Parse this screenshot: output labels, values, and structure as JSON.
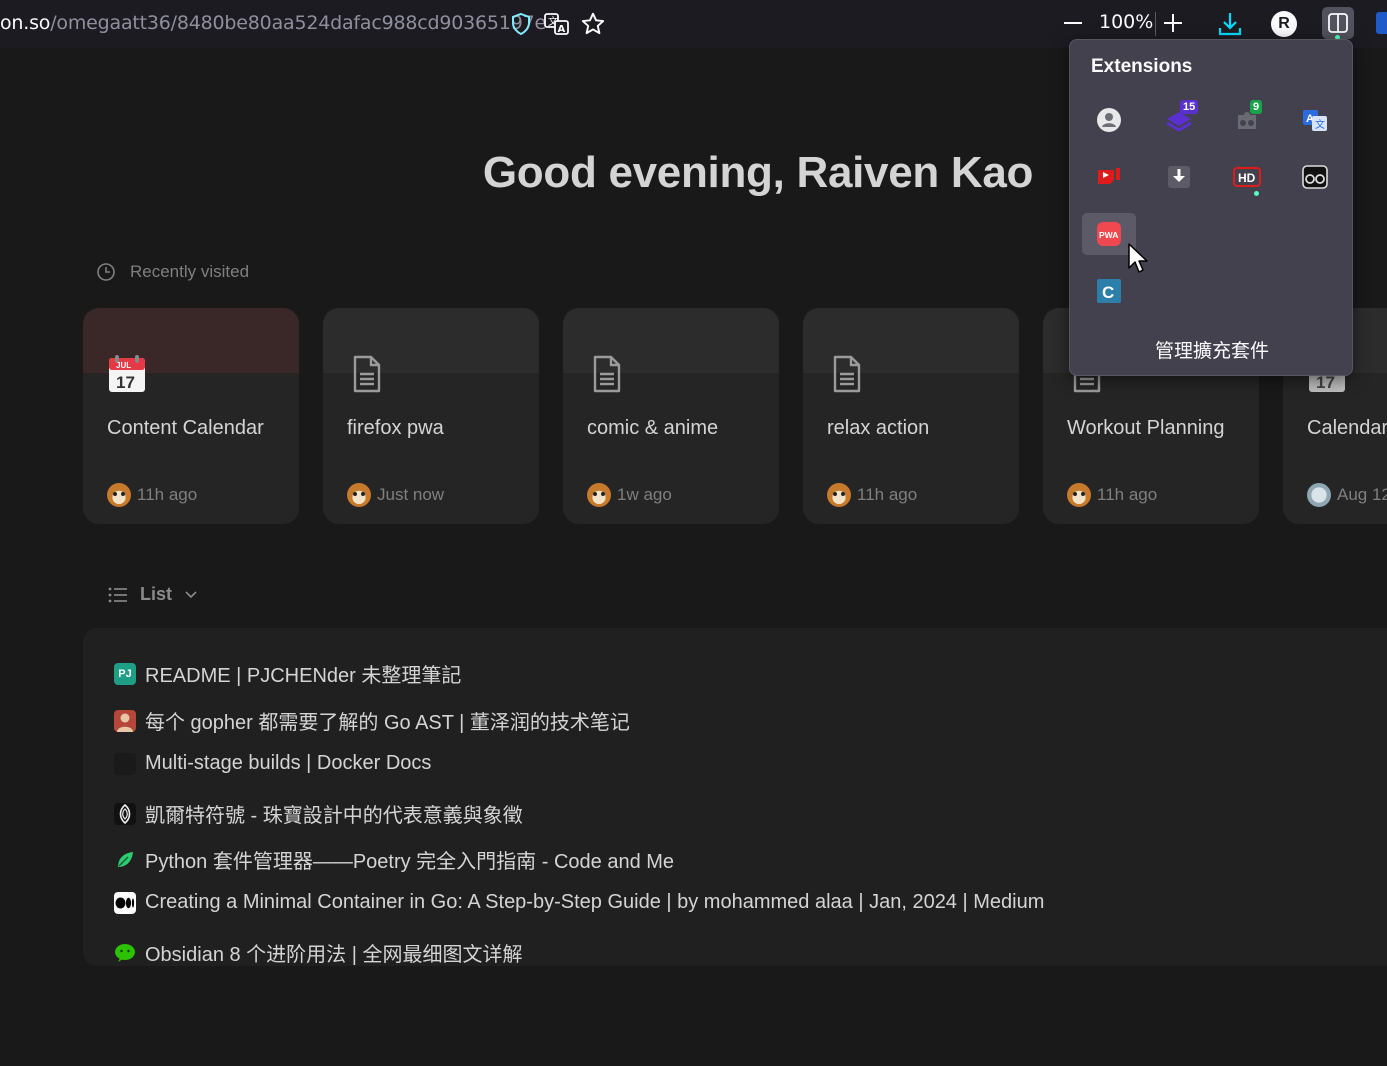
{
  "browser": {
    "url_prefix": "on.so",
    "url_path": "/omegaatt36/8480be80aa524dafac988cd90365197e",
    "zoom": "100%",
    "profile_initial": "R"
  },
  "page": {
    "greeting": "Good evening, Raiven Kao",
    "recent_label": "Recently visited",
    "recent": [
      {
        "title": "Content Calendar",
        "time": "11h ago",
        "icon": "calendar-icon"
      },
      {
        "title": "firefox pwa",
        "time": "Just now",
        "icon": "page-icon"
      },
      {
        "title": "comic & anime",
        "time": "1w ago",
        "icon": "page-icon"
      },
      {
        "title": "relax action",
        "time": "11h ago",
        "icon": "page-icon"
      },
      {
        "title": "Workout Planning",
        "time": "11h ago",
        "icon": "page-icon"
      },
      {
        "title": "Calendar",
        "time": "Aug 12",
        "icon": "calendar-icon"
      }
    ],
    "list_label": "List",
    "list_items": [
      {
        "text": "README | PJCHENder 未整理筆記",
        "icon": "pjchender-icon"
      },
      {
        "text": "每个 gopher 都需要了解的 Go AST | 董泽润的技术笔记",
        "icon": "person-avatar-icon"
      },
      {
        "text": "Multi-stage builds | Docker Docs",
        "icon": "docker-icon"
      },
      {
        "text": "凱爾特符號 - 珠寶設計中的代表意義與象徵",
        "icon": "celtic-icon"
      },
      {
        "text": "Python 套件管理器——Poetry 完全入門指南 - Code and Me",
        "icon": "leaf-icon"
      },
      {
        "text": "Creating a Minimal Container in Go: A Step-by-Step Guide | by mohammed alaa | Jan, 2024 | Medium",
        "icon": "medium-icon"
      },
      {
        "text": "Obsidian 8 个进阶用法 | 全网最细图文详解",
        "icon": "wechat-icon"
      }
    ]
  },
  "extensions": {
    "title": "Extensions",
    "manage_label": "管理擴充套件",
    "badge_15": "15",
    "badge_9": "9",
    "hd_label": "HD",
    "pwa_label": "PWA",
    "c_label": "C"
  },
  "colors": {
    "background": "#191919",
    "card": "#252525",
    "popup": "#42414d",
    "accent_blue": "#00ddff"
  }
}
